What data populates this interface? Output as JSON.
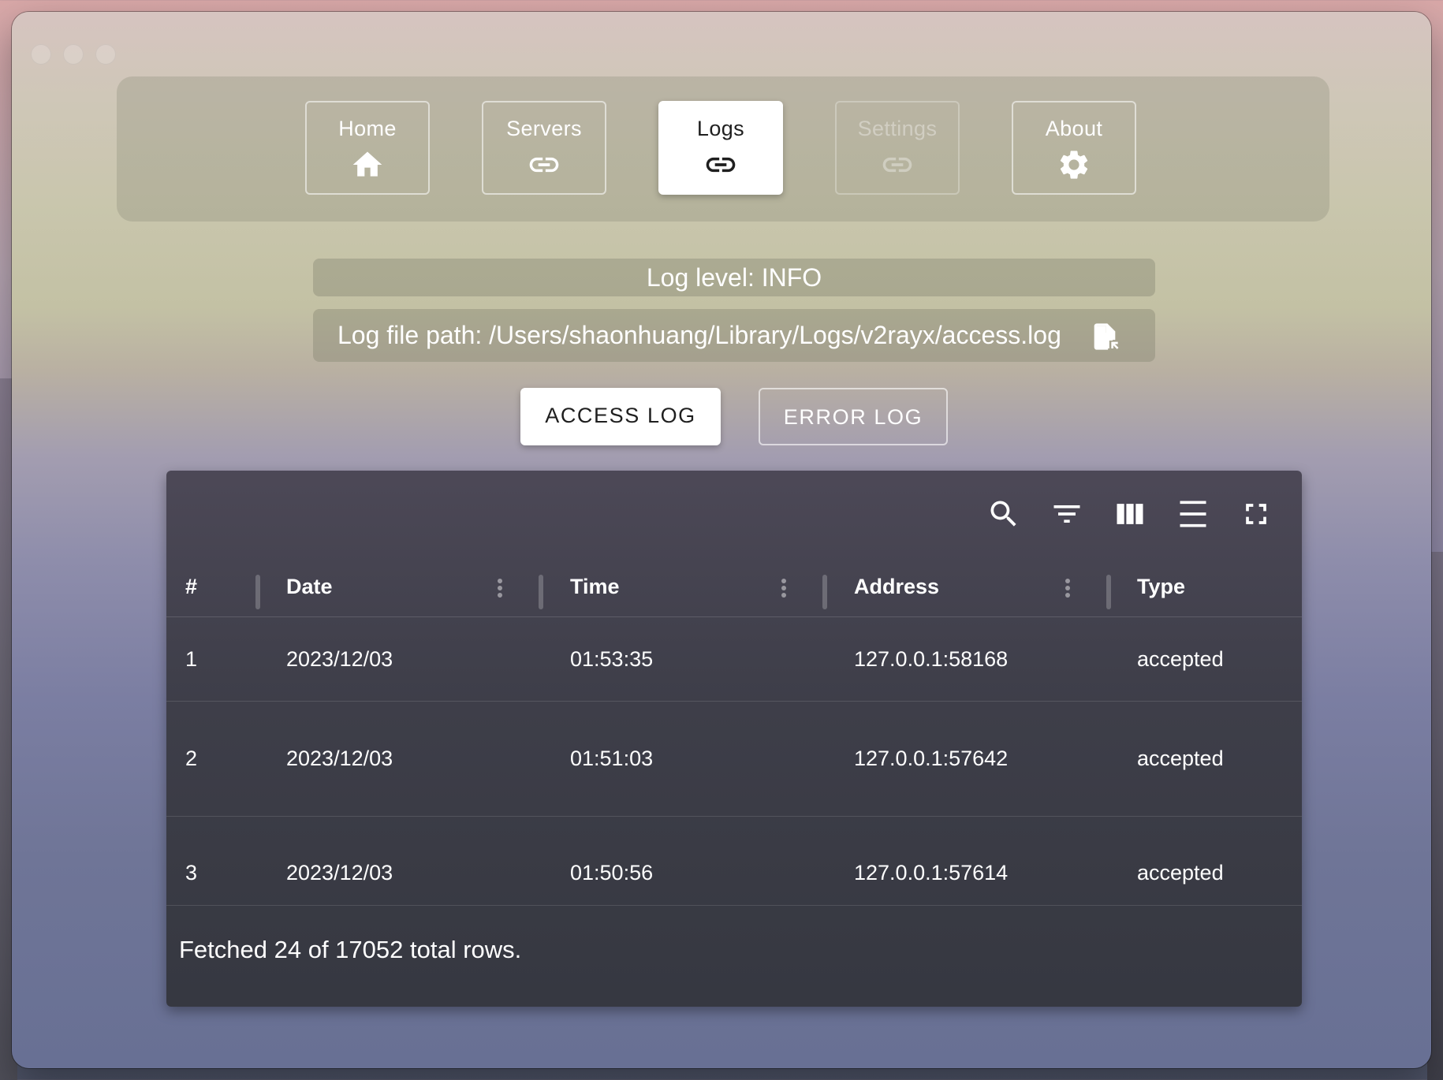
{
  "nav": {
    "items": [
      {
        "label": "Home",
        "icon": "home-icon"
      },
      {
        "label": "Servers",
        "icon": "link-icon"
      },
      {
        "label": "Logs",
        "icon": "link-icon",
        "state": "active"
      },
      {
        "label": "Settings",
        "icon": "link-icon",
        "state": "disabled"
      },
      {
        "label": "About",
        "icon": "gear-icon"
      }
    ]
  },
  "log_info": {
    "level": "Log level: INFO",
    "path": "Log file path: /Users/shaonhuang/Library/Logs/v2rayx/access.log"
  },
  "log_tabs": {
    "access": "ACCESS LOG",
    "error": "ERROR LOG",
    "selected": "ACCESS LOG"
  },
  "table": {
    "toolbar_icons": [
      "search-icon",
      "filter-icon",
      "columns-icon",
      "density-icon",
      "fullscreen-icon"
    ],
    "headers": [
      "#",
      "Date",
      "Time",
      "Address",
      "Type"
    ],
    "rows": [
      {
        "num": "1",
        "date": "2023/12/03",
        "time": "01:53:35",
        "address": "127.0.0.1:58168",
        "type": "accepted"
      },
      {
        "num": "2",
        "date": "2023/12/03",
        "time": "01:51:03",
        "address": "127.0.0.1:57642",
        "type": "accepted"
      },
      {
        "num": "3",
        "date": "2023/12/03",
        "time": "01:50:56",
        "address": "127.0.0.1:57614",
        "type": "accepted"
      }
    ],
    "footer": "Fetched 24 of 17052 total rows."
  },
  "colors": {
    "active_tab_bg": "#ffffff",
    "table_bg": "#3c3c46",
    "text_light": "#ffffff"
  }
}
